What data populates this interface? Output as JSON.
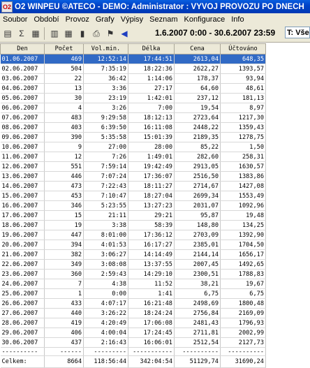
{
  "window": {
    "title": "O2 WINPEU ©ATECO - DEMO: Administrator : VÝVOJ PROVOZU PO DNECH",
    "app_icon": "O2"
  },
  "menu": [
    "Soubor",
    "Období",
    "Provoz",
    "Grafy",
    "Výpisy",
    "Seznam",
    "Konfigurace",
    "Info"
  ],
  "toolbar": {
    "period": "1.6.2007 0:00 - 30.6.2007 23:59",
    "type_filter": "T: Vše"
  },
  "table": {
    "columns": [
      "Den",
      "Počet",
      "Vol.min.",
      "Délka",
      "Cena",
      "Účtováno"
    ],
    "rows": [
      [
        "01.06.2007",
        "469",
        "12:52:14",
        "17:44:51",
        "2613,04",
        "648,35"
      ],
      [
        "02.06.2007",
        "504",
        "7:35:19",
        "18:22:36",
        "2622,27",
        "1393,57"
      ],
      [
        "03.06.2007",
        "22",
        "36:42",
        "1:14:06",
        "178,37",
        "93,94"
      ],
      [
        "04.06.2007",
        "13",
        "3:36",
        "27:17",
        "64,60",
        "48,61"
      ],
      [
        "05.06.2007",
        "30",
        "23:19",
        "1:42:01",
        "237,12",
        "181,13"
      ],
      [
        "06.06.2007",
        "4",
        "3:26",
        "7:00",
        "19,54",
        "8,97"
      ],
      [
        "07.06.2007",
        "483",
        "9:29:58",
        "18:12:13",
        "2723,64",
        "1217,30"
      ],
      [
        "08.06.2007",
        "403",
        "6:39:50",
        "16:11:08",
        "2448,22",
        "1359,43"
      ],
      [
        "09.06.2007",
        "390",
        "5:35:58",
        "15:01:39",
        "2189,35",
        "1278,75"
      ],
      [
        "10.06.2007",
        "9",
        "27:00",
        "28:00",
        "85,22",
        "1,50"
      ],
      [
        "11.06.2007",
        "12",
        "7:26",
        "1:49:01",
        "282,60",
        "258,31"
      ],
      [
        "12.06.2007",
        "551",
        "7:59:14",
        "19:42:49",
        "2913,05",
        "1630,57"
      ],
      [
        "13.06.2007",
        "446",
        "7:07:24",
        "17:36:07",
        "2516,50",
        "1383,86"
      ],
      [
        "14.06.2007",
        "473",
        "7:22:43",
        "18:11:27",
        "2714,67",
        "1427,08"
      ],
      [
        "15.06.2007",
        "453",
        "7:10:47",
        "18:27:04",
        "2699,34",
        "1553,49"
      ],
      [
        "16.06.2007",
        "346",
        "5:23:55",
        "13:27:23",
        "2031,07",
        "1092,96"
      ],
      [
        "17.06.2007",
        "15",
        "21:11",
        "29:21",
        "95,87",
        "19,48"
      ],
      [
        "18.06.2007",
        "19",
        "3:38",
        "58:39",
        "148,80",
        "134,25"
      ],
      [
        "19.06.2007",
        "447",
        "8:01:00",
        "17:36:12",
        "2703,09",
        "1392,90"
      ],
      [
        "20.06.2007",
        "394",
        "4:01:53",
        "16:17:27",
        "2385,01",
        "1704,50"
      ],
      [
        "21.06.2007",
        "382",
        "3:06:27",
        "14:14:49",
        "2144,14",
        "1656,17"
      ],
      [
        "22.06.2007",
        "349",
        "3:08:08",
        "13:37:55",
        "2007,45",
        "1492,65"
      ],
      [
        "23.06.2007",
        "360",
        "2:59:43",
        "14:29:10",
        "2300,51",
        "1788,83"
      ],
      [
        "24.06.2007",
        "7",
        "4:38",
        "11:52",
        "38,21",
        "19,67"
      ],
      [
        "25.06.2007",
        "1",
        "0:00",
        "1:41",
        "6,75",
        "6,75"
      ],
      [
        "26.06.2007",
        "433",
        "4:07:17",
        "16:21:48",
        "2498,69",
        "1800,48"
      ],
      [
        "27.06.2007",
        "440",
        "3:26:22",
        "18:24:24",
        "2756,84",
        "2169,09"
      ],
      [
        "28.06.2007",
        "419",
        "4:20:49",
        "17:06:08",
        "2481,43",
        "1796,93"
      ],
      [
        "29.06.2007",
        "406",
        "4:00:04",
        "17:24:45",
        "2711,81",
        "2002,99"
      ],
      [
        "30.06.2007",
        "437",
        "2:16:43",
        "16:06:01",
        "2512,54",
        "2127,73"
      ]
    ],
    "selected_row": 0,
    "separator": [
      "----------",
      "------",
      "---------",
      "-----------",
      "----------",
      "----------"
    ],
    "total": [
      "Celkem:",
      "8664",
      "118:56:44",
      "342:04:54",
      "51129,74",
      "31690,24"
    ]
  }
}
